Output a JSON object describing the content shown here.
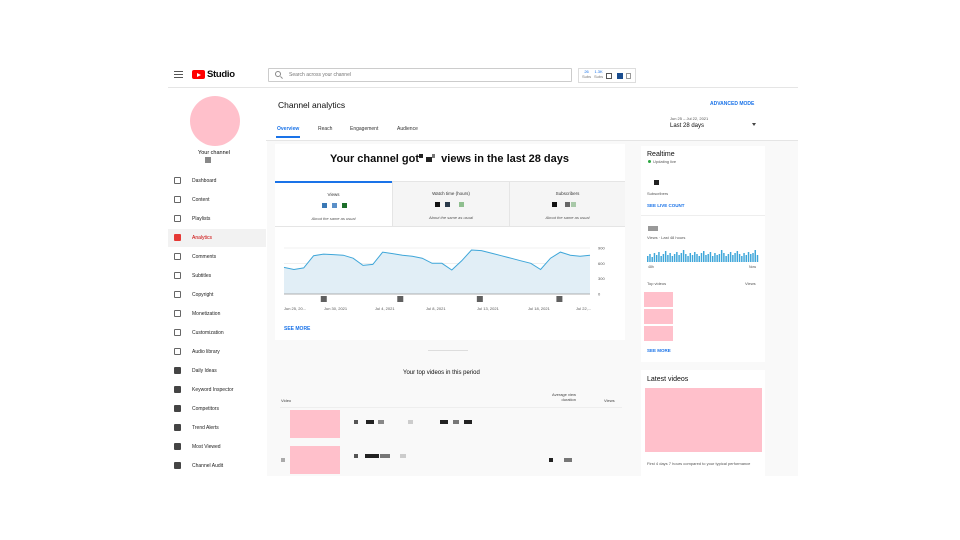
{
  "app": {
    "logo_text": "Studio",
    "search_placeholder": "Search across your channel",
    "extension": {
      "item1_top": "26",
      "item1_bottom": "Subs",
      "item2_top": "1.3K",
      "item2_bottom": "Subs"
    }
  },
  "sidebar": {
    "channel_label": "Your channel",
    "items": [
      {
        "label": "Dashboard",
        "icon": "dashboard-icon",
        "active": false
      },
      {
        "label": "Content",
        "icon": "content-icon",
        "active": false
      },
      {
        "label": "Playlists",
        "icon": "playlists-icon",
        "active": false
      },
      {
        "label": "Analytics",
        "icon": "analytics-icon",
        "active": true
      },
      {
        "label": "Comments",
        "icon": "comments-icon",
        "active": false
      },
      {
        "label": "Subtitles",
        "icon": "subtitles-icon",
        "active": false
      },
      {
        "label": "Copyright",
        "icon": "copyright-icon",
        "active": false
      },
      {
        "label": "Monetization",
        "icon": "monetization-icon",
        "active": false
      },
      {
        "label": "Customization",
        "icon": "customization-icon",
        "active": false
      },
      {
        "label": "Audio library",
        "icon": "audio-library-icon",
        "active": false
      },
      {
        "label": "Daily Ideas",
        "icon": "daily-ideas-icon",
        "active": false
      },
      {
        "label": "Keyword Inspector",
        "icon": "keyword-inspector-icon",
        "active": false
      },
      {
        "label": "Competitors",
        "icon": "competitors-icon",
        "active": false
      },
      {
        "label": "Trend Alerts",
        "icon": "trend-alerts-icon",
        "active": false
      },
      {
        "label": "Most Viewed",
        "icon": "most-viewed-icon",
        "active": false
      },
      {
        "label": "Channel Audit",
        "icon": "channel-audit-icon",
        "active": false
      }
    ]
  },
  "header": {
    "title": "Channel analytics",
    "advanced_mode": "ADVANCED MODE",
    "tabs": [
      "Overview",
      "Reach",
      "Engagement",
      "Audience"
    ],
    "date_range": "Jun 25 – Jul 22, 2021",
    "date_label": "Last 28 days"
  },
  "overview": {
    "headline_prefix": "Your channel got",
    "headline_suffix": "views in the last 28 days",
    "metrics": [
      {
        "name": "Views",
        "note": "About the same as usual",
        "colors": [
          "#3a78b5",
          "#5a8fc8",
          "#1d6f2a"
        ]
      },
      {
        "name": "Watch time (hours)",
        "note": "About the same as usual",
        "colors": [
          "#111",
          "#2a3a4a",
          "#8fbf8f"
        ]
      },
      {
        "name": "Subscribers",
        "note": "About the same as usual",
        "colors": [
          "#111",
          "#666",
          "#a9c9a9"
        ]
      }
    ],
    "see_more": "SEE MORE"
  },
  "chart_data": {
    "type": "area",
    "x": [
      "Jun 25, 20...",
      "Jun 30, 2021",
      "Jul 4, 2021",
      "Jul 8, 2021",
      "Jul 13, 2021",
      "Jul 18, 2021",
      "Jul 22,..."
    ],
    "y_ticks": [
      "900",
      "600",
      "300",
      "0"
    ],
    "ylim": [
      0,
      900
    ],
    "series": [
      {
        "values": [
          520,
          480,
          510,
          750,
          780,
          770,
          760,
          700,
          560,
          580,
          820,
          790,
          760,
          740,
          700,
          600,
          600,
          470,
          650,
          860,
          850,
          800,
          750,
          700,
          650,
          600,
          480,
          700,
          820,
          760,
          740,
          760
        ]
      }
    ],
    "color": "#3ea6d9",
    "fill": "#e1eef6",
    "grid": true
  },
  "top_videos": {
    "title": "Your top videos in this period",
    "columns": {
      "video": "Video",
      "avg_duration": "Average view duration",
      "views": "Views"
    }
  },
  "realtime": {
    "title": "Realtime",
    "updating": "Updating live",
    "subscribers_label": "Subscribers",
    "see_live_count": "SEE LIVE COUNT",
    "views_label": "Views · Last 48 hours",
    "axis_left": "48h",
    "axis_right": "Now",
    "top_videos_label": "Top videos",
    "views_col": "Views",
    "see_more": "SEE MORE"
  },
  "latest_videos": {
    "title": "Latest videos",
    "note": "First 4 days 7 hours compared to your typical performance"
  }
}
